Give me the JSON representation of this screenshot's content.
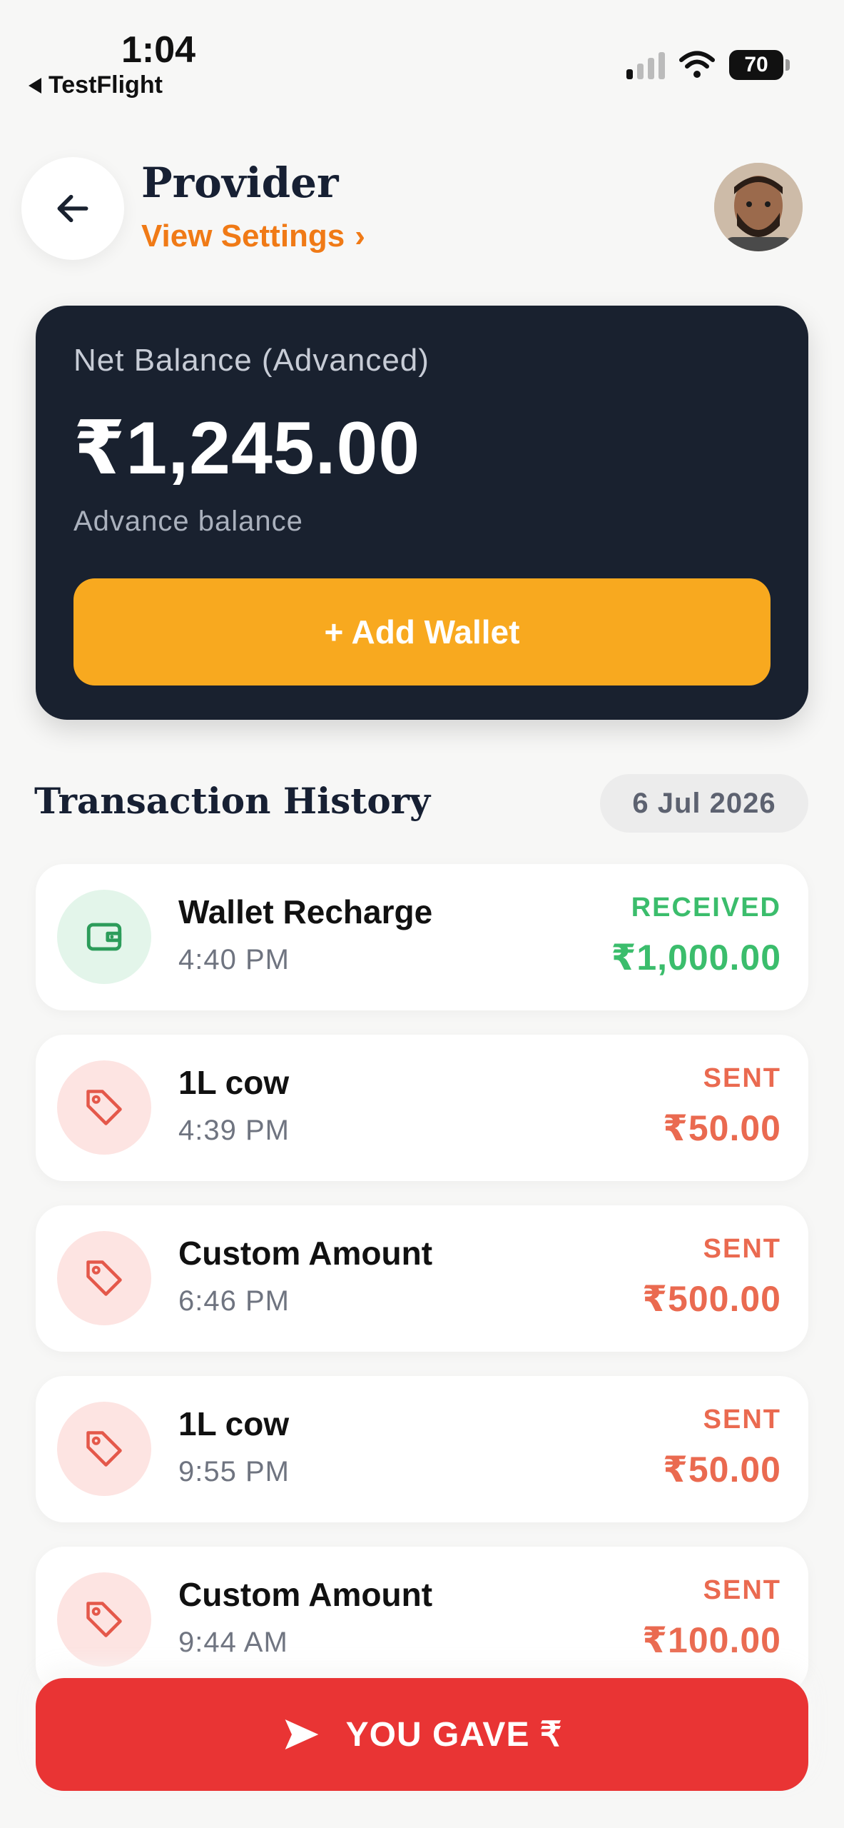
{
  "status_bar": {
    "time": "1:04",
    "back_app": "TestFlight",
    "battery": "70"
  },
  "header": {
    "title": "Provider",
    "settings_link": "View Settings",
    "settings_chevron": "›"
  },
  "balance_card": {
    "label": "Net Balance (Advanced)",
    "amount": "₹1,245.00",
    "subtitle": "Advance balance",
    "add_wallet_label": "+ Add Wallet"
  },
  "history": {
    "title": "Transaction History",
    "date": "6 Jul 2026",
    "transactions": [
      {
        "name": "Wallet Recharge",
        "time": "4:40 PM",
        "status": "RECEIVED",
        "amount": "₹1,000.00",
        "icon": "wallet-icon"
      },
      {
        "name": "1L cow",
        "time": "4:39 PM",
        "status": "SENT",
        "amount": "₹50.00",
        "icon": "tag-icon"
      },
      {
        "name": "Custom Amount",
        "time": "6:46 PM",
        "status": "SENT",
        "amount": "₹500.00",
        "icon": "tag-icon"
      },
      {
        "name": "1L cow",
        "time": "9:55 PM",
        "status": "SENT",
        "amount": "₹50.00",
        "icon": "tag-icon"
      },
      {
        "name": "Custom Amount",
        "time": "9:44 AM",
        "status": "SENT",
        "amount": "₹100.00",
        "icon": "tag-icon"
      }
    ]
  },
  "bottom_action": {
    "label": "YOU GAVE ₹"
  },
  "colors": {
    "accent_orange": "#f07a16",
    "card_dark": "#19212f",
    "add_wallet": "#f8a91f",
    "received_green": "#3bbd6c",
    "sent_red": "#ea6a50",
    "you_gave_red": "#e93434"
  }
}
